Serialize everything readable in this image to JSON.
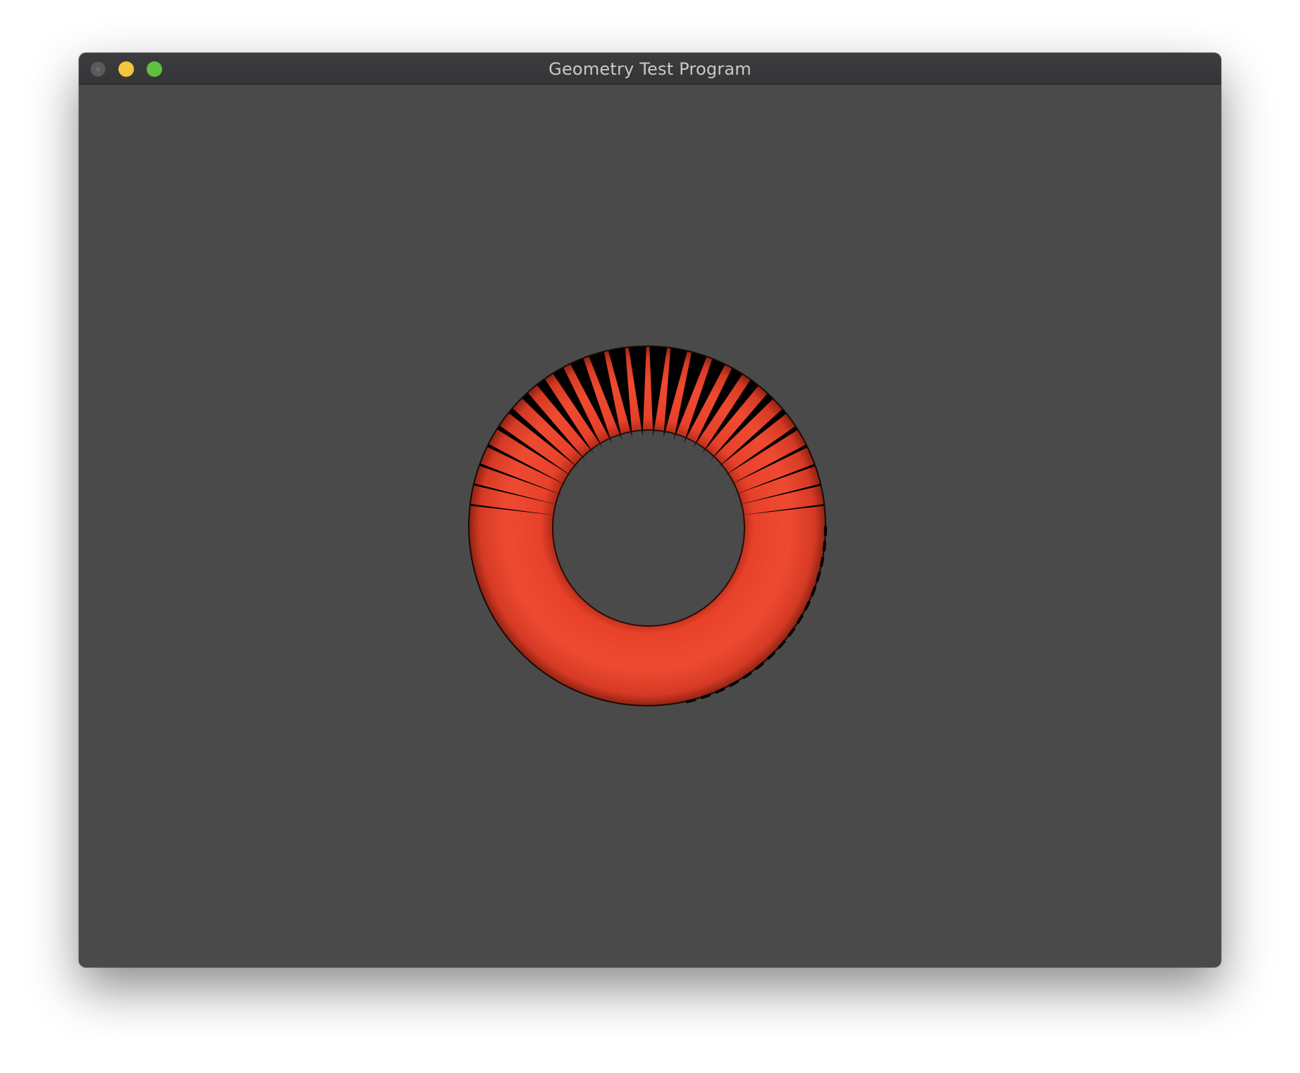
{
  "window": {
    "title": "Geometry Test Program",
    "controls": {
      "close_icon": "close-icon",
      "minimize_icon": "minimize-icon",
      "zoom_icon": "zoom-icon"
    }
  },
  "viewport": {
    "background": "#4a4a4a",
    "object": "torus",
    "object_color": "#e8412a",
    "wire_color": "#000000"
  }
}
